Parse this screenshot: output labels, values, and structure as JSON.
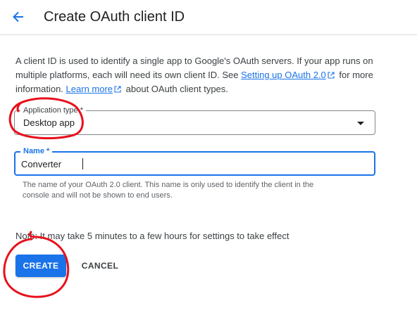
{
  "header": {
    "title": "Create OAuth client ID",
    "back_icon": "arrow-back-icon"
  },
  "intro": {
    "line1": "A client ID is used to identify a single app to Google's OAuth servers. If your app runs on",
    "line2_pre": "multiple platforms, each will need its own client ID. See ",
    "setup_link": "Setting up OAuth 2.0",
    "line2_post": " for more",
    "line3_pre": "information. ",
    "learn_link": "Learn more",
    "line3_post": " about OAuth client types."
  },
  "application_type": {
    "label": "Application type *",
    "value": "Desktop app"
  },
  "name_field": {
    "label": "Name *",
    "value": "Converter",
    "helper_line1": "The name of your OAuth 2.0 client. This name is only used to identify the client in the",
    "helper_line2": "console and will not be shown to end users."
  },
  "note": "Note: It may take 5 minutes to a few hours for settings to take effect",
  "buttons": {
    "create": "CREATE",
    "cancel": "CANCEL"
  },
  "colors": {
    "primary": "#1a73e8",
    "annotation": "#e8101b"
  }
}
